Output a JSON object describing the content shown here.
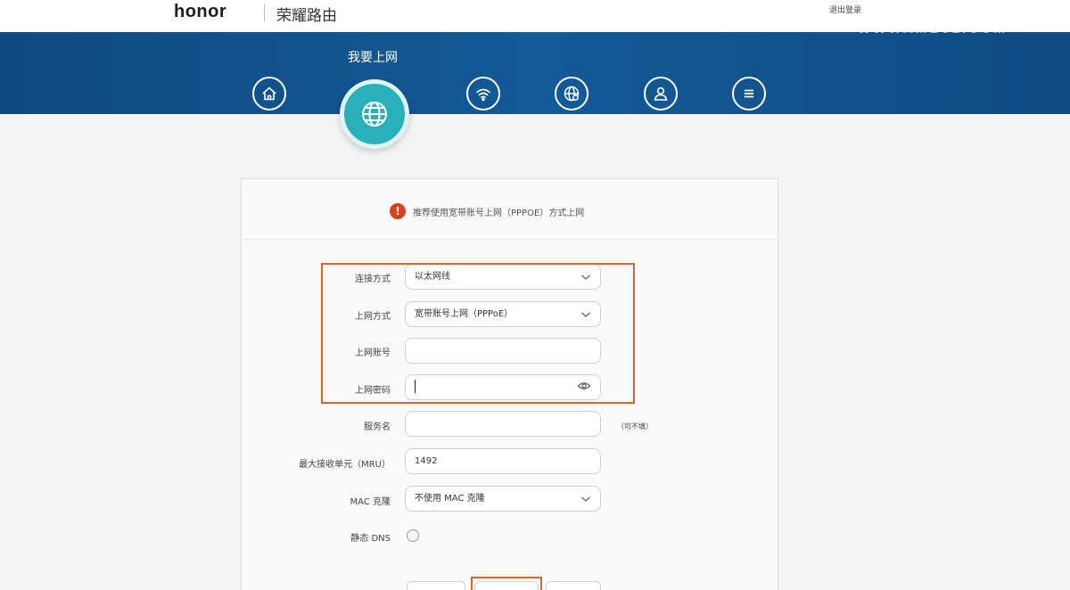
{
  "header": {
    "logo": "honor",
    "product": "荣耀路由",
    "logout": "退出登录",
    "watermark": "WWW.IMB31.COM"
  },
  "nav": {
    "active_label": "我要上网",
    "items": [
      {
        "icon": "home-icon"
      },
      {
        "icon": "globe-icon",
        "active": true
      },
      {
        "icon": "wifi-icon"
      },
      {
        "icon": "globe-settings-icon"
      },
      {
        "icon": "user-icon"
      },
      {
        "icon": "menu-icon"
      }
    ]
  },
  "notice": {
    "icon_text": "!",
    "text": "推荐使用宽带账号上网（PPPOE）方式上网"
  },
  "form": {
    "connection_type": {
      "label": "连接方式",
      "value": "以太网线"
    },
    "internet_mode": {
      "label": "上网方式",
      "value": "宽带账号上网（PPPoE）"
    },
    "account": {
      "label": "上网账号",
      "value": ""
    },
    "password": {
      "label": "上网密码",
      "value": ""
    },
    "service_name": {
      "label": "服务名",
      "value": "",
      "hint": "（可不填）"
    },
    "mru": {
      "label": "最大接收单元（MRU）",
      "value": "1492"
    },
    "mac_clone": {
      "label": "MAC 克隆",
      "value": "不使用 MAC 克隆"
    },
    "static_dns": {
      "label": "静态 DNS"
    }
  },
  "colors": {
    "banner": "#135a96",
    "active_nav": "#2ab0b8",
    "highlight": "#e2622b",
    "warning": "#d9401e"
  }
}
